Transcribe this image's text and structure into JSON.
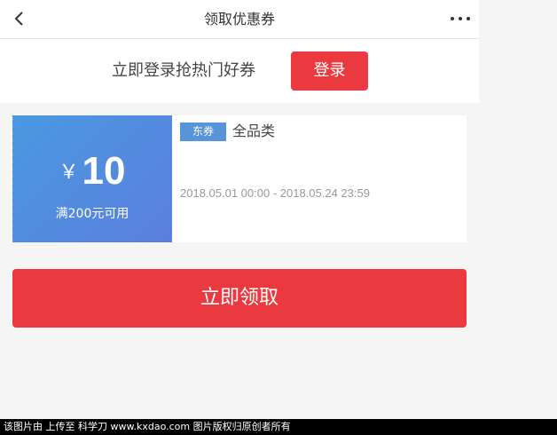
{
  "header": {
    "title": "领取优惠券",
    "back_icon": "chevron-left-icon",
    "more_icon": "more-horizontal-icon"
  },
  "login_bar": {
    "prompt": "立即登录抢热门好券",
    "button_label": "登录"
  },
  "coupon": {
    "currency": "￥",
    "amount": "10",
    "condition": "满200元可用",
    "tag": "东券",
    "category": "全品类",
    "validity": "2018.05.01 00:00 - 2018.05.24 23:59"
  },
  "claim_button": {
    "label": "立即领取"
  },
  "watermark": {
    "text": "该图片由  上传至 科学刀 www.kxdao.com 图片版权归原创者所有"
  },
  "colors": {
    "accent_red": "#ea3a3f",
    "coupon_blue": "#4a99e0",
    "tag_blue": "#5894d8"
  }
}
